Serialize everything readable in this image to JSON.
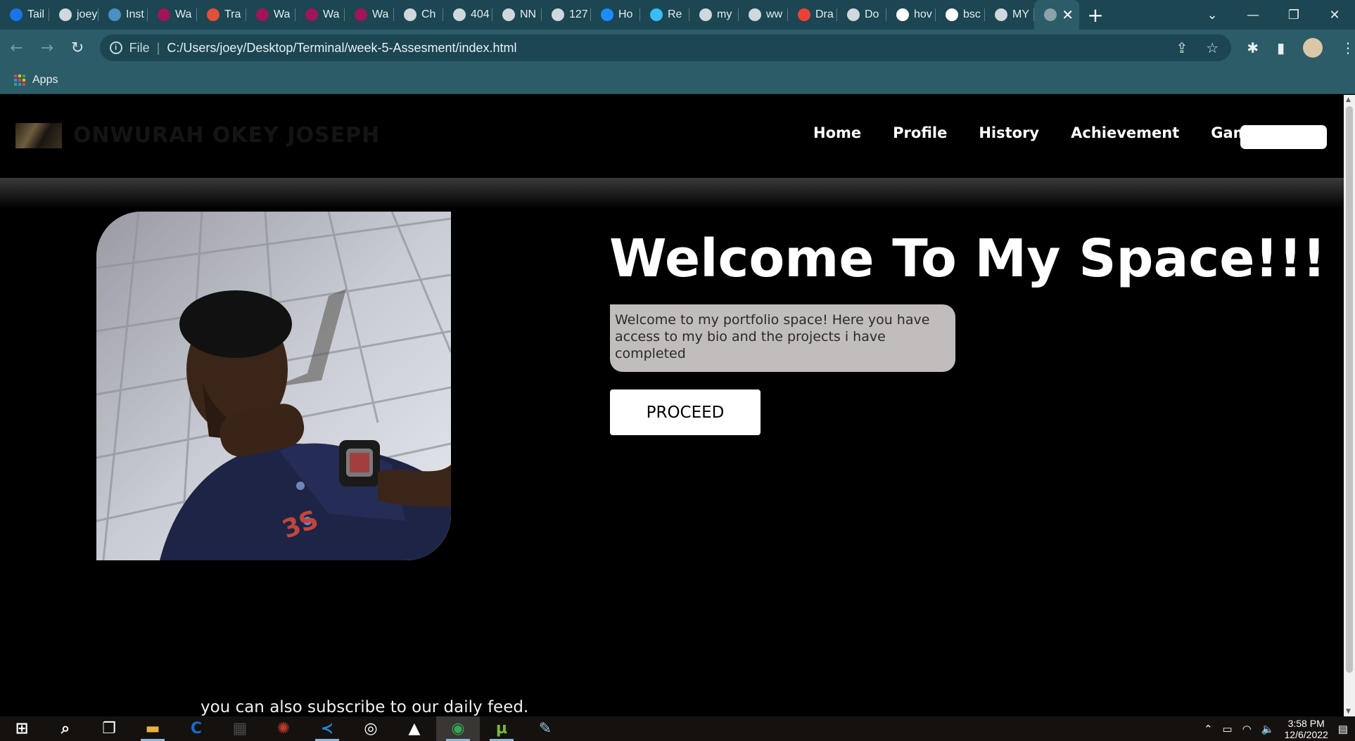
{
  "browser": {
    "tabs": [
      {
        "label": "Tail",
        "icon": "tailwind-icon",
        "color": "#1a73e8"
      },
      {
        "label": "joey",
        "icon": "loading-icon",
        "color": "#cfd8dc"
      },
      {
        "label": "Inst",
        "icon": "site-icon",
        "color": "#4a90c2"
      },
      {
        "label": "Wa",
        "icon": "figma-icon",
        "color": "#a0145a"
      },
      {
        "label": "Tra",
        "icon": "site-icon",
        "color": "#e0503a"
      },
      {
        "label": "Wa",
        "icon": "figma-icon",
        "color": "#a0145a"
      },
      {
        "label": "Wa",
        "icon": "figma-icon",
        "color": "#a0145a"
      },
      {
        "label": "Wa",
        "icon": "figma-icon",
        "color": "#a0145a"
      },
      {
        "label": "Ch",
        "icon": "openai-icon",
        "color": "#cfd8dc"
      },
      {
        "label": "404",
        "icon": "loading-icon",
        "color": "#cfd8dc"
      },
      {
        "label": "NN",
        "icon": "globe-icon",
        "color": "#cfd8dc"
      },
      {
        "label": "127",
        "icon": "openai-icon",
        "color": "#cfd8dc"
      },
      {
        "label": "Ho",
        "icon": "site-icon",
        "color": "#1a8cff"
      },
      {
        "label": "Re",
        "icon": "tailwind-icon",
        "color": "#38bdf8"
      },
      {
        "label": "my",
        "icon": "globe-icon",
        "color": "#cfd8dc"
      },
      {
        "label": "ww",
        "icon": "openai-icon",
        "color": "#cfd8dc"
      },
      {
        "label": "Dra",
        "icon": "gmail-icon",
        "color": "#ea4335"
      },
      {
        "label": "Do",
        "icon": "globe-icon",
        "color": "#cfd8dc"
      },
      {
        "label": "hov",
        "icon": "google-icon",
        "color": "#ffffff"
      },
      {
        "label": "bsc",
        "icon": "google-icon",
        "color": "#ffffff"
      },
      {
        "label": "MY",
        "icon": "globe-icon",
        "color": "#cfd8dc"
      }
    ],
    "active_tab_close": "✕",
    "new_tab": "+",
    "url_scheme": "File",
    "url": "C:/Users/joey/Desktop/Terminal/week-5-Assesment/index.html",
    "bookmarks_apps": "Apps"
  },
  "site": {
    "brand": "ONWURAH OKEY JOSEPH",
    "nav": [
      "Home",
      "Profile",
      "History",
      "Achievement",
      "Games"
    ],
    "hero_title": "Welcome To My Space!!!",
    "hero_text": "Welcome to my portfolio space! Here you have access to my bio and the projects i have completed",
    "proceed_label": "PROCEED",
    "subscribe_text": "you can also subscribe to our daily feed."
  },
  "taskbar": {
    "apps": [
      {
        "name": "start-icon"
      },
      {
        "name": "search-icon"
      },
      {
        "name": "task-view-icon"
      },
      {
        "name": "file-explorer-icon",
        "color": "#e8b43a"
      },
      {
        "name": "ccleaner-icon",
        "color": "#1b6ac9"
      },
      {
        "name": "calculator-icon",
        "color": "#4a4a4a"
      },
      {
        "name": "app-icon",
        "color": "#c0392b"
      },
      {
        "name": "vscode-icon",
        "color": "#1f8ad2"
      },
      {
        "name": "groove-icon",
        "color": "#ffffff"
      },
      {
        "name": "photos-icon",
        "color": "#ffffff"
      },
      {
        "name": "chrome-icon",
        "color": "#34a853"
      },
      {
        "name": "utorrent-icon",
        "color": "#78b83c"
      },
      {
        "name": "paint-icon",
        "color": "#9ac0e0"
      }
    ],
    "time": "3:58 PM",
    "date": "12/6/2022"
  }
}
